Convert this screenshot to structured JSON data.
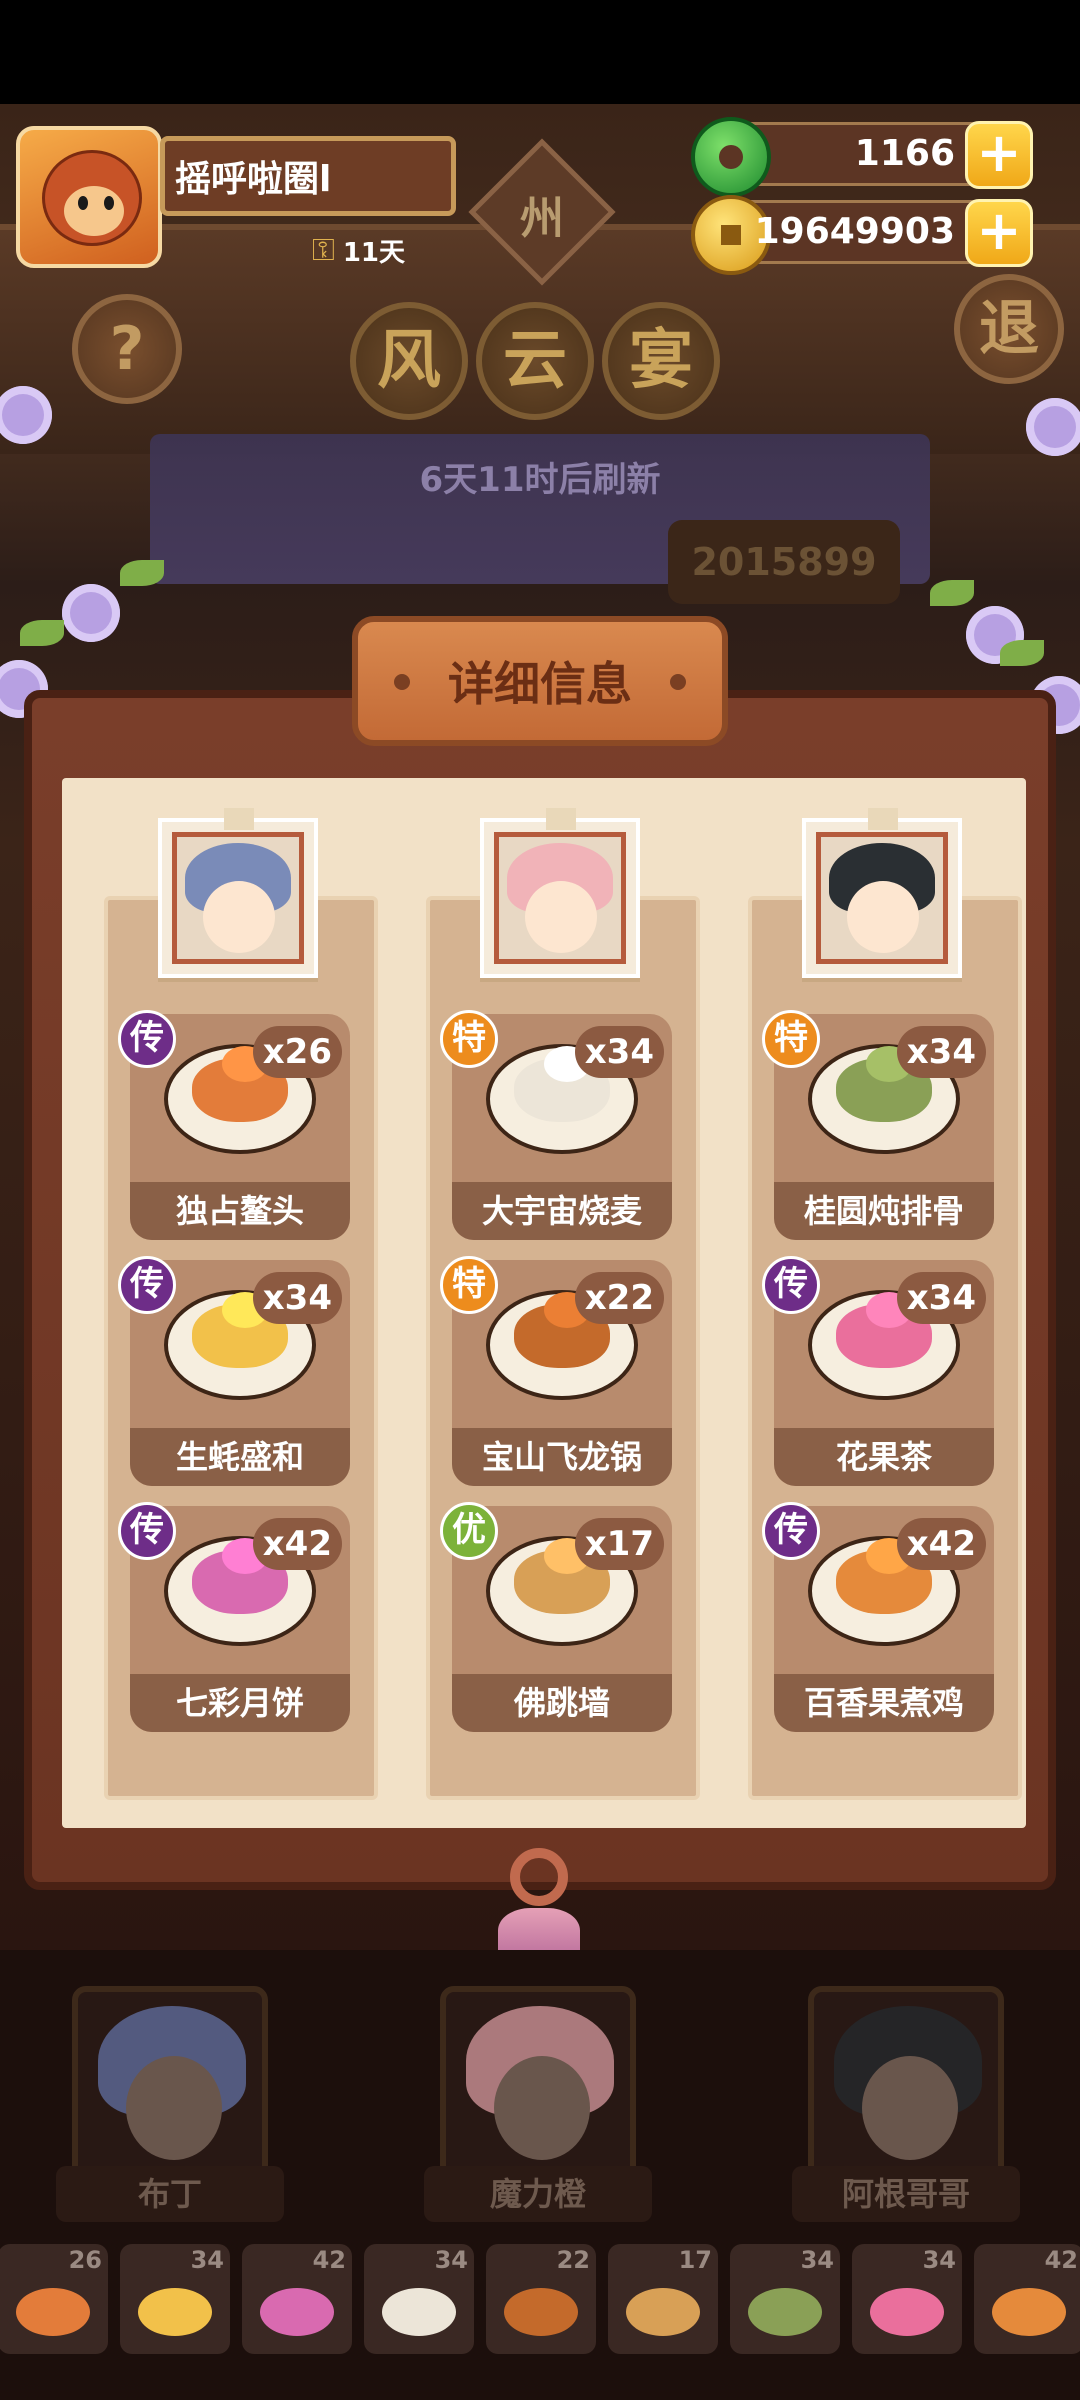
{
  "player": {
    "name": "摇呼啦圈l",
    "days": "11天"
  },
  "sign": "州",
  "currency": {
    "jade": "1166",
    "gold": "19649903"
  },
  "buttons": {
    "help": "?",
    "exit": "退"
  },
  "event_title": [
    "风",
    "云",
    "宴"
  ],
  "refresh_text": "6天11时后刷新",
  "score": "2015899",
  "panel": {
    "title": "详细信息",
    "columns": [
      {
        "hero": "布丁",
        "hair_color": "#7a8bb8",
        "dishes": [
          {
            "name": "独占鳌头",
            "count": "x26",
            "badge": "传",
            "tier": "purple",
            "color": "#e37c3a"
          },
          {
            "name": "生蚝盛和",
            "count": "x34",
            "badge": "传",
            "tier": "purple",
            "color": "#f2c14a"
          },
          {
            "name": "七彩月饼",
            "count": "x42",
            "badge": "传",
            "tier": "purple",
            "color": "#d96ab0"
          }
        ]
      },
      {
        "hero": "魔力橙",
        "hair_color": "#f1b3b8",
        "dishes": [
          {
            "name": "大宇宙烧麦",
            "count": "x34",
            "badge": "特",
            "tier": "orange",
            "color": "#ece5d8"
          },
          {
            "name": "宝山飞龙锅",
            "count": "x22",
            "badge": "特",
            "tier": "orange",
            "color": "#c46a2b"
          },
          {
            "name": "佛跳墙",
            "count": "x17",
            "badge": "优",
            "tier": "green",
            "color": "#d8a056"
          }
        ]
      },
      {
        "hero": "阿根哥哥",
        "hair_color": "#2a2f33",
        "dishes": [
          {
            "name": "桂圆炖排骨",
            "count": "x34",
            "badge": "特",
            "tier": "orange",
            "color": "#8aa056"
          },
          {
            "name": "花果茶",
            "count": "x34",
            "badge": "传",
            "tier": "purple",
            "color": "#ea6f9c"
          },
          {
            "name": "百香果煮鸡",
            "count": "x42",
            "badge": "传",
            "tier": "purple",
            "color": "#e58a3b"
          }
        ]
      }
    ]
  },
  "team": [
    {
      "name": "布丁",
      "hair": "#6b7bb0"
    },
    {
      "name": "魔力橙",
      "hair": "#e8a6ac"
    },
    {
      "name": "阿根哥哥",
      "hair": "#2a2f33"
    }
  ],
  "slots": [
    {
      "count": "26",
      "color": "#e37c3a"
    },
    {
      "count": "34",
      "color": "#f2c14a"
    },
    {
      "count": "42",
      "color": "#d96ab0"
    },
    {
      "count": "34",
      "color": "#ece5d8"
    },
    {
      "count": "22",
      "color": "#c46a2b"
    },
    {
      "count": "17",
      "color": "#d8a056"
    },
    {
      "count": "34",
      "color": "#8aa056"
    },
    {
      "count": "34",
      "color": "#ea6f9c"
    },
    {
      "count": "42",
      "color": "#e58a3b"
    }
  ]
}
